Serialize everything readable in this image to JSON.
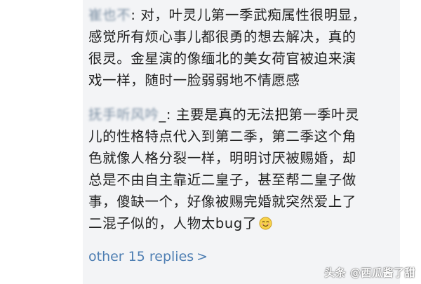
{
  "comments": [
    {
      "author": "崔也不",
      "separator": ":",
      "lines": [
        " 对，叶灵儿第一季武痴属性很明显，",
        "感觉所有烦心事儿都很勇的想去解决，真的",
        "很灵。金星演的像缅北的美女荷官被迫来演",
        "戏一样，随时一脸弱弱地不情愿感"
      ]
    },
    {
      "author": "抚手听风吟",
      "separator": "_:",
      "lines": [
        " 主要是真的无法把第一季叶灵",
        "儿的性格特点代入到第二季，第二季这个角",
        "色就像人格分裂一样，明明讨厌被赐婚，却",
        "总是不由自主靠近二皇子，甚至帮二皇子做",
        "事，傻缺一个，好像被赐完婚就突然爱上了",
        "二混子似的，人物太bug了"
      ],
      "emoji": "smile-emoji"
    }
  ],
  "more_replies": {
    "label": "other 15 replies",
    "chevron": ">"
  },
  "watermark": "头条 @西瓜酱了甜",
  "colors": {
    "panel_bg": "#f3f4f6",
    "text": "#1f1f1f",
    "author": "#7b8fa3",
    "link": "#4f7fb3"
  }
}
